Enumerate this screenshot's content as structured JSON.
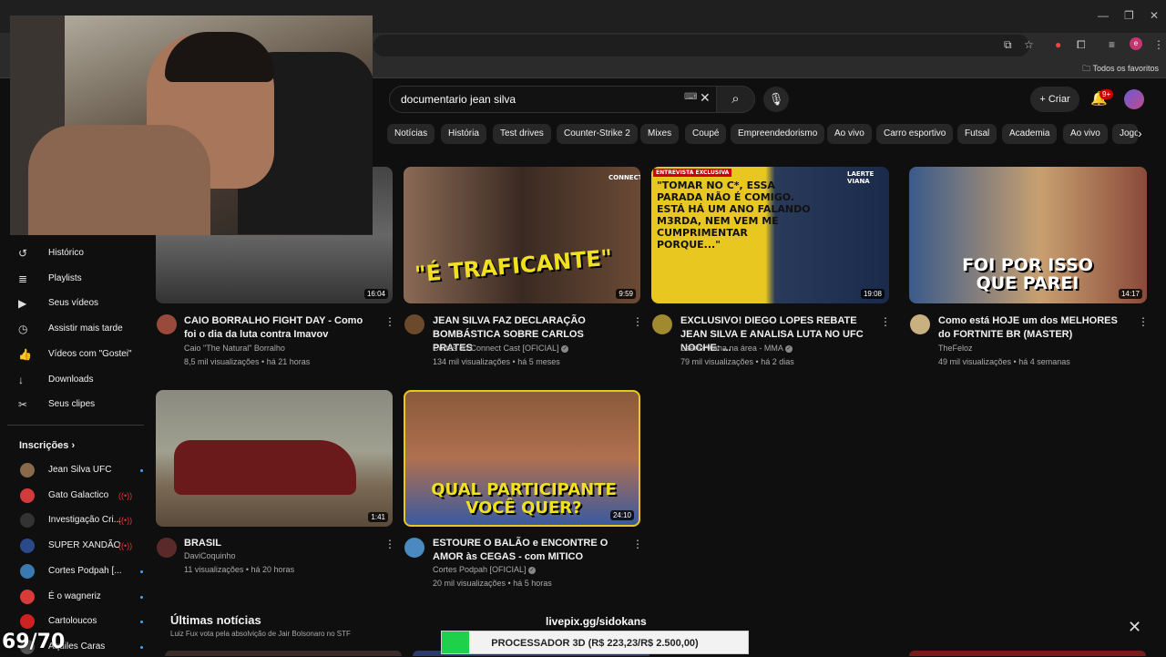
{
  "browser": {
    "bookmarks_label": "Todos os favoritos"
  },
  "search": {
    "query": "documentario jean silva"
  },
  "header": {
    "create_label": "Criar",
    "notifications_badge": "9+"
  },
  "chips": [
    "Notícias",
    "História",
    "Test drives",
    "Counter-Strike 2",
    "Mixes",
    "Coupé",
    "Empreendedorismo",
    "Ao vivo",
    "Carro esportivo",
    "Futsal",
    "Academia",
    "Ao vivo",
    "Jogo"
  ],
  "sidebar": {
    "items": [
      {
        "label": "Histórico",
        "icon": "history-icon"
      },
      {
        "label": "Playlists",
        "icon": "playlist-icon"
      },
      {
        "label": "Seus vídeos",
        "icon": "your-videos-icon"
      },
      {
        "label": "Assistir mais tarde",
        "icon": "watch-later-icon"
      },
      {
        "label": "Vídeos com \"Gostei\"",
        "icon": "like-icon"
      },
      {
        "label": "Downloads",
        "icon": "download-icon"
      },
      {
        "label": "Seus clipes",
        "icon": "clip-icon"
      }
    ],
    "subscriptions_title": "Inscrições",
    "subscriptions": [
      {
        "label": "Jean Silva UFC",
        "color": "#8a6a4a",
        "live": false
      },
      {
        "label": "Gato Galactico",
        "color": "#d23b3b",
        "live": true
      },
      {
        "label": "Investigação Cri...",
        "color": "#333333",
        "live": true
      },
      {
        "label": "SUPER XANDÃO",
        "color": "#2a4a8a",
        "live": true
      },
      {
        "label": "Cortes Podpah [...",
        "color": "#3a7ab0",
        "live": false
      },
      {
        "label": "É o wagneriz",
        "color": "#d93a3a",
        "live": false
      },
      {
        "label": "Cartoloucos",
        "color": "#c22",
        "live": false
      },
      {
        "label": "Aquiles Caras",
        "color": "#555",
        "live": false
      }
    ]
  },
  "videos": [
    {
      "title": "CAIO BORRALHO FIGHT DAY - Como foi o dia da luta contra Imavov",
      "channel": "Caio \"The Natural\" Borralho",
      "verified": false,
      "views": "8,5 mil visualizações",
      "age": "há 21 horas",
      "duration": "16:04"
    },
    {
      "title": "JEAN SILVA FAZ DECLARAÇÃO BOMBÁSTICA SOBRE CARLOS PRATES",
      "channel": "Cortes do Connect Cast [OFICIAL]",
      "verified": true,
      "views": "134 mil visualizações",
      "age": "há 5 meses",
      "duration": "9:59",
      "thumb_text": "\"É TRAFICANTE\"",
      "thumb_brand": "CONNECT"
    },
    {
      "title": "EXCLUSIVO! DIEGO LOPES REBATE JEAN SILVA E ANALISA LUTA NO UFC NOCHE: ...",
      "channel": "Laerte Viana na área - MMA",
      "verified": true,
      "views": "79 mil visualizações",
      "age": "há 2 dias",
      "duration": "19:08",
      "thumb_tag": "ENTREVISTA EXCLUSIVA",
      "thumb_quote": "\"TOMAR NO C*, ESSA PARADA NÃO É COMIGO. ESTÁ HÁ UM ANO FALANDO M3RDA, NEM VEM ME CUMPRIMENTAR PORQUE...\"",
      "thumb_brand": "LAERTE VIANA"
    },
    {
      "title": "Como está HOJE um dos MELHORES do FORTNITE BR (MASTER)",
      "channel": "TheFeloz",
      "verified": false,
      "views": "49 mil visualizações",
      "age": "há 4 semanas",
      "duration": "14:17",
      "thumb_text": "FOI POR ISSO QUE PAREI"
    },
    {
      "title": "BRASIL",
      "channel": "DaviCoquinho",
      "verified": false,
      "views": "11 visualizações",
      "age": "há 20 horas",
      "duration": "1:41"
    },
    {
      "title": "ESTOURE O BALÃO e ENCONTRE O AMOR às CEGAS - com MITICO",
      "channel": "Cortes Podpah [OFICIAL]",
      "verified": true,
      "views": "20 mil visualizações",
      "age": "há 5 horas",
      "duration": "24:10",
      "thumb_text": "QUAL PARTICIPANTE VOCÊ QUER?"
    }
  ],
  "news": {
    "title": "Últimas notícias",
    "subtitle": "Luiz Fux vota pela absolvição de Jair Bolsonaro no STF"
  },
  "overlay": {
    "livepix": "livepix.gg/sidokans",
    "goal_text": "PROCESSADOR 3D (R$ 223,23/R$ 2.500,00)",
    "goal_progress": 0.0893,
    "counter": "69/70"
  }
}
